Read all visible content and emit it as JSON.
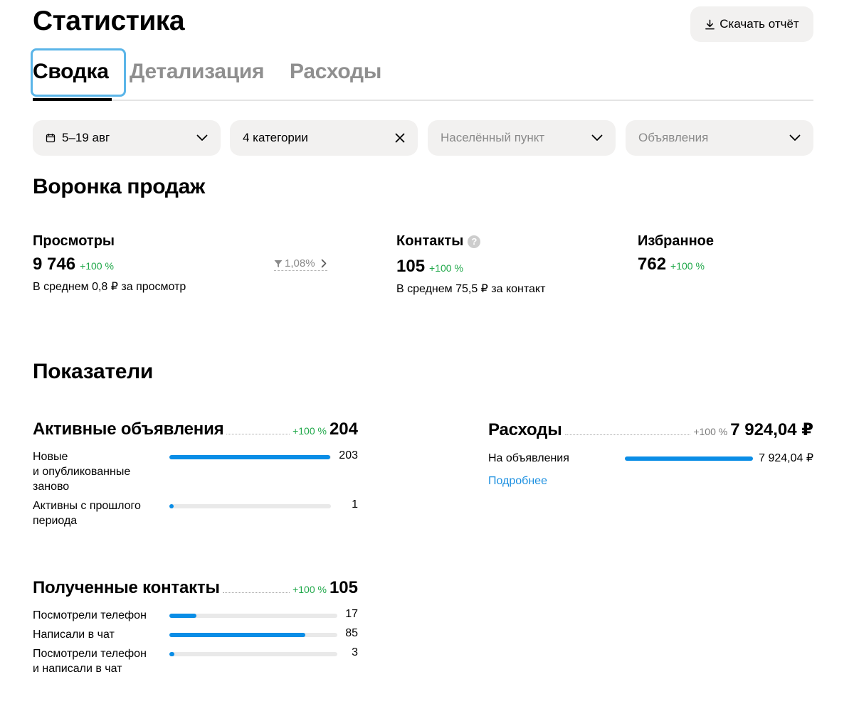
{
  "header": {
    "title": "Статистика",
    "download_label": "Скачать отчёт"
  },
  "tabs": [
    {
      "label": "Сводка",
      "active": true
    },
    {
      "label": "Детализация",
      "active": false
    },
    {
      "label": "Расходы",
      "active": false
    }
  ],
  "filters": {
    "period": "5–19 авг",
    "categories": "4 категории",
    "location_placeholder": "Населённый пункт",
    "listings_placeholder": "Объявления"
  },
  "funnel": {
    "title": "Воронка продаж",
    "views": {
      "label": "Просмотры",
      "value": "9 746",
      "growth": "+100 %",
      "sub": "В среднем 0,8 ₽ за просмотр",
      "conversion": "1,08%"
    },
    "contacts": {
      "label": "Контакты",
      "value": "105",
      "growth": "+100 %",
      "sub": "В среднем 75,5 ₽ за контакт"
    },
    "favorites": {
      "label": "Избранное",
      "value": "762",
      "growth": "+100 %"
    }
  },
  "indicators": {
    "title": "Показатели",
    "active_listings": {
      "title": "Активные объявления",
      "growth": "+100 %",
      "total": "204",
      "rows": [
        {
          "label_lines": [
            "Новые",
            "и опубликованные",
            "заново"
          ],
          "value": "203",
          "fill": 0.995
        },
        {
          "label_lines": [
            "Активны с прошлого",
            "периода"
          ],
          "value": "1",
          "fill": 0.02
        }
      ]
    },
    "expenses": {
      "title": "Расходы",
      "growth": "+100 %",
      "total": "7 924,04 ₽",
      "rows": [
        {
          "label": "На объявления",
          "value": "7 924,04 ₽",
          "fill": 1.0
        }
      ],
      "more_link": "Подробнее"
    },
    "contacts_received": {
      "title": "Полученные контакты",
      "growth": "+100 %",
      "total": "105",
      "rows": [
        {
          "label_lines": [
            "Посмотрели телефон"
          ],
          "value": "17",
          "fill": 0.16
        },
        {
          "label_lines": [
            "Написали в чат"
          ],
          "value": "85",
          "fill": 0.81
        },
        {
          "label_lines": [
            "Посмотрели телефон",
            "и написали в чат"
          ],
          "value": "3",
          "fill": 0.03
        }
      ]
    }
  },
  "colors": {
    "accent": "#0a8de6",
    "growth": "#20a84a",
    "chip_bg": "#f2f1f0",
    "focus_ring": "#5bb5e8",
    "link": "#1b8fe0"
  },
  "icons": {
    "download": "download-icon",
    "calendar": "calendar-icon",
    "chevron": "chevron-down-icon",
    "clear": "close-icon",
    "help": "question-icon",
    "funnel": "funnel-icon",
    "arrow": "chevron-right-icon"
  }
}
